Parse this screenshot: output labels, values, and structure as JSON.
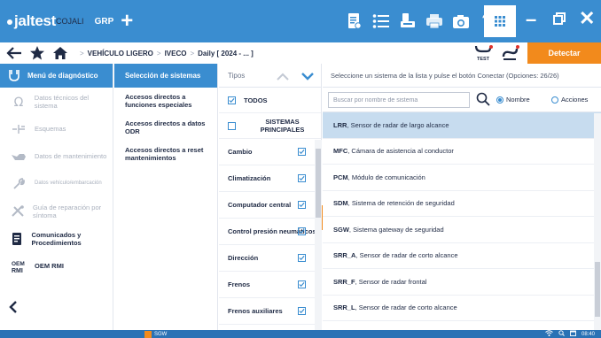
{
  "app": {
    "brand": "jaltest",
    "brand_sub": "COJALI",
    "mode": "GRP"
  },
  "nav": {
    "breadcrumb": [
      "VEHÍCULO LIGERO",
      "IVECO",
      "Daily [ 2024 - ... ]"
    ],
    "test_label": "TEST",
    "detect_label": "Detectar"
  },
  "sidebar": {
    "header": "Menú de diagnóstico",
    "items": [
      {
        "label": "Datos técnicos del sistema",
        "active": false,
        "icon": "omega-icon"
      },
      {
        "label": "Esquemas",
        "active": false,
        "icon": "schematic-icon"
      },
      {
        "label": "Datos de mantenimiento",
        "active": false,
        "icon": "oil-can-icon"
      },
      {
        "label": "Datos vehículo/embarcación",
        "active": false,
        "icon": "wrench-icon"
      },
      {
        "label": "Guía de reparación por síntoma",
        "active": false,
        "icon": "tools-icon"
      },
      {
        "label": "Comunicados y Procedimientos",
        "active": true,
        "icon": "document-icon"
      },
      {
        "label": "OEM RMI",
        "active": true,
        "icon": "oem-rmi-icon"
      }
    ]
  },
  "systems_selection": {
    "header": "Selección de sistemas",
    "items": [
      "Accesos directos a funciones especiales",
      "Accesos directos a datos ODR",
      "Accesos directos a reset mantenimientos"
    ]
  },
  "types": {
    "header": "Tipos",
    "all_label": "TODOS",
    "main_label": "SISTEMAS PRINCIPALES",
    "items": [
      "Cambio",
      "Climatización",
      "Computador central",
      "Control presión neumáticos",
      "Dirección",
      "Frenos",
      "Frenos auxiliares"
    ]
  },
  "system_list": {
    "instruction": "Seleccione un sistema de la lista y pulse el botón Conectar (Opciones: 26/26)",
    "search_placeholder": "Buscar por nombre de sistema",
    "radio_name": "Nombre",
    "radio_actions": "Acciones",
    "items": [
      {
        "code": "LRR",
        "name": ", Sensor de radar de largo alcance",
        "selected": true
      },
      {
        "code": "MFC",
        "name": ", Cámara de asistencia al conductor",
        "selected": false
      },
      {
        "code": "PCM",
        "name": ", Módulo de comunicación",
        "selected": false
      },
      {
        "code": "SDM",
        "name": ", Sistema de retención de seguridad",
        "selected": false
      },
      {
        "code": "SGW",
        "name": ", Sistema gateway de seguridad",
        "selected": false
      },
      {
        "code": "SRR_A",
        "name": ", Sensor de radar de corto alcance",
        "selected": false
      },
      {
        "code": "SRR_F",
        "name": ", Sensor de radar frontal",
        "selected": false
      },
      {
        "code": "SRR_L",
        "name": ", Sensor de radar de corto alcance",
        "selected": false
      }
    ]
  },
  "taskbar": {
    "app_label": "SGW",
    "time": "08:40"
  },
  "colors": {
    "primary": "#3a8dd0",
    "accent": "#f28a1c",
    "selected_row": "#c7dcef",
    "taskbar": "#2a72b5"
  }
}
